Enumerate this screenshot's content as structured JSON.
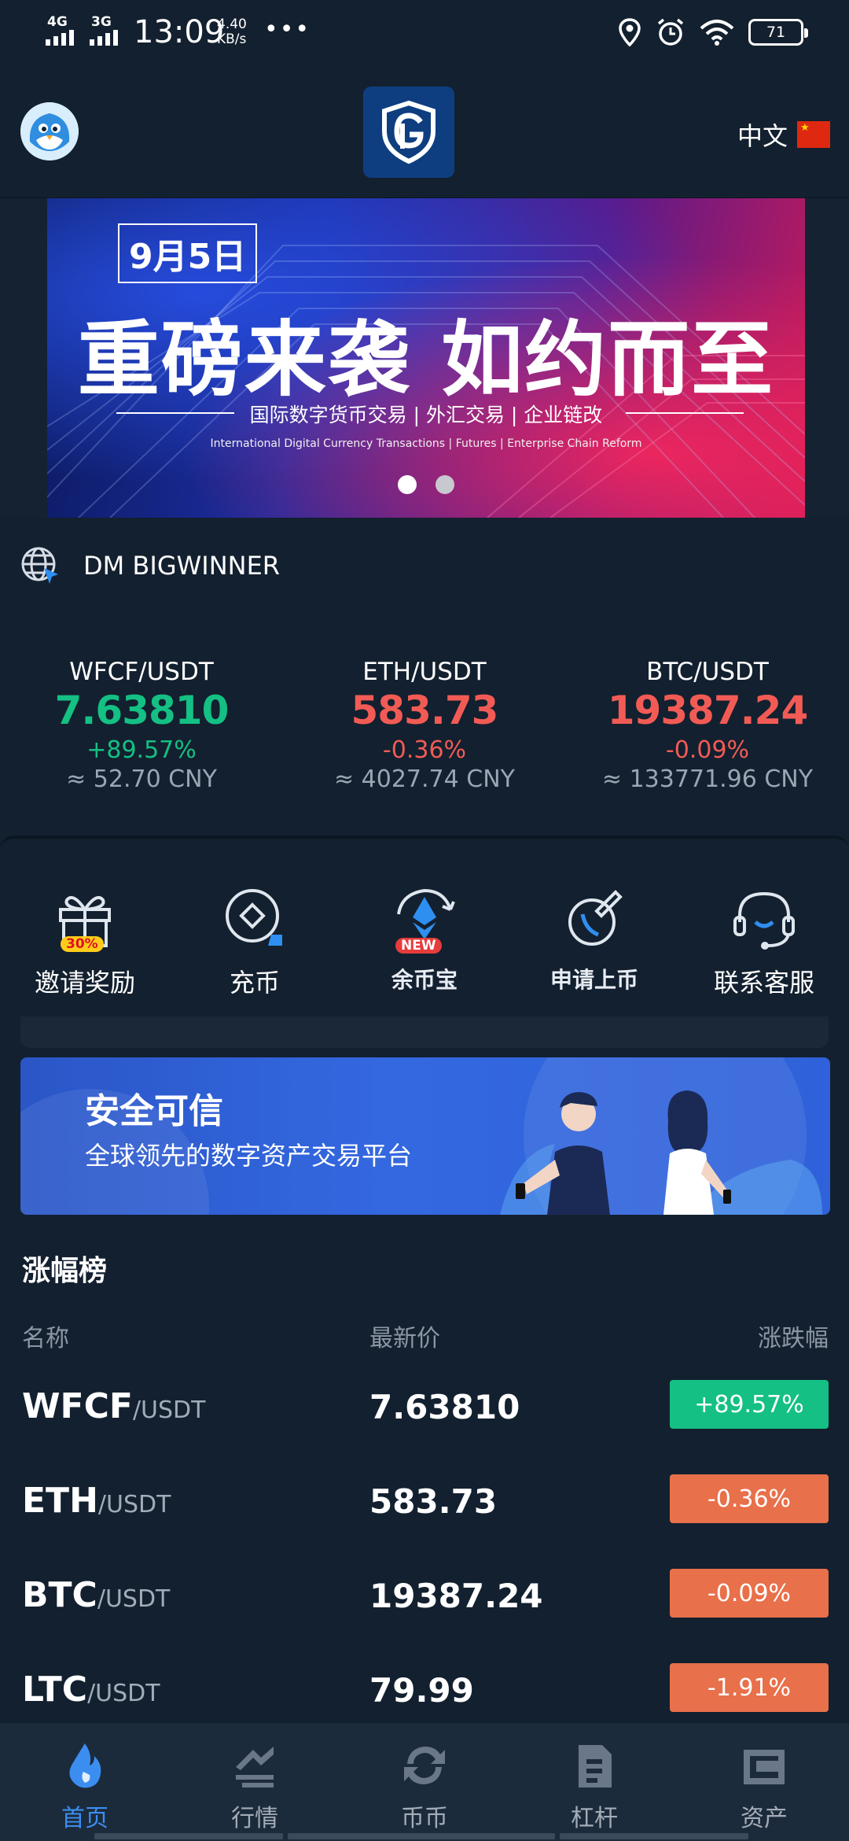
{
  "status_bar": {
    "network_1": "4G",
    "network_2": "3G",
    "time": "13:09",
    "speed_value": "4.40",
    "speed_unit": "KB/s",
    "more": "•••",
    "battery": "71"
  },
  "header": {
    "language": "中文",
    "colors": {
      "logo_bg": "#0e3e80",
      "page_bg": "#13202f"
    }
  },
  "banner": {
    "date": "9月5日",
    "title": "重磅来袭 如约而至",
    "subtitle": "国际数字货币交易 | 外汇交易 | 企业链改",
    "subtitle_en": "International Digital Currency Transactions | Futures | Enterprise Chain Reform",
    "active_slide": 1,
    "slide_count": 2
  },
  "notice": {
    "icon": "globe-icon",
    "text": "DM BIGWINNER"
  },
  "tickers": [
    {
      "pair": "WFCF/USDT",
      "price": "7.63810",
      "change": "+89.57%",
      "cny": "≈ 52.70 CNY",
      "trend": "up"
    },
    {
      "pair": "ETH/USDT",
      "price": "583.73",
      "change": "-0.36%",
      "cny": "≈ 4027.74 CNY",
      "trend": "down"
    },
    {
      "pair": "BTC/USDT",
      "price": "19387.24",
      "change": "-0.09%",
      "cny": "≈ 133771.96 CNY",
      "trend": "down"
    }
  ],
  "actions": [
    {
      "label": "邀请奖励",
      "icon": "gift-icon",
      "tag": "30%"
    },
    {
      "label": "充币",
      "icon": "deposit-icon"
    },
    {
      "label": "余币宝",
      "icon": "ethereum-icon",
      "tag": "NEW"
    },
    {
      "label": "申请上币",
      "icon": "listing-icon"
    },
    {
      "label": "联系客服",
      "icon": "headset-icon"
    }
  ],
  "promo": {
    "title": "安全可信",
    "subtitle": "全球领先的数字资产交易平台"
  },
  "ranking": {
    "title": "涨幅榜",
    "col_name": "名称",
    "col_price": "最新价",
    "col_change": "涨跌幅",
    "rows": [
      {
        "base": "WFCF",
        "quote": "/USDT",
        "price": "7.63810",
        "change": "+89.57%",
        "trend": "up"
      },
      {
        "base": "ETH",
        "quote": "/USDT",
        "price": "583.73",
        "change": "-0.36%",
        "trend": "down"
      },
      {
        "base": "BTC",
        "quote": "/USDT",
        "price": "19387.24",
        "change": "-0.09%",
        "trend": "down"
      },
      {
        "base": "LTC",
        "quote": "/USDT",
        "price": "79.99",
        "change": "-1.91%",
        "trend": "down"
      }
    ]
  },
  "bottom_nav": [
    {
      "label": "首页",
      "icon": "flame-icon",
      "active": true
    },
    {
      "label": "行情",
      "icon": "market-icon"
    },
    {
      "label": "币币",
      "icon": "exchange-icon"
    },
    {
      "label": "杠杆",
      "icon": "leverage-icon"
    },
    {
      "label": "资产",
      "icon": "wallet-icon"
    }
  ],
  "colors": {
    "up": "#14c083",
    "down": "#f25b55",
    "down_badge": "#e8704a",
    "active_nav": "#3b8ef0"
  }
}
